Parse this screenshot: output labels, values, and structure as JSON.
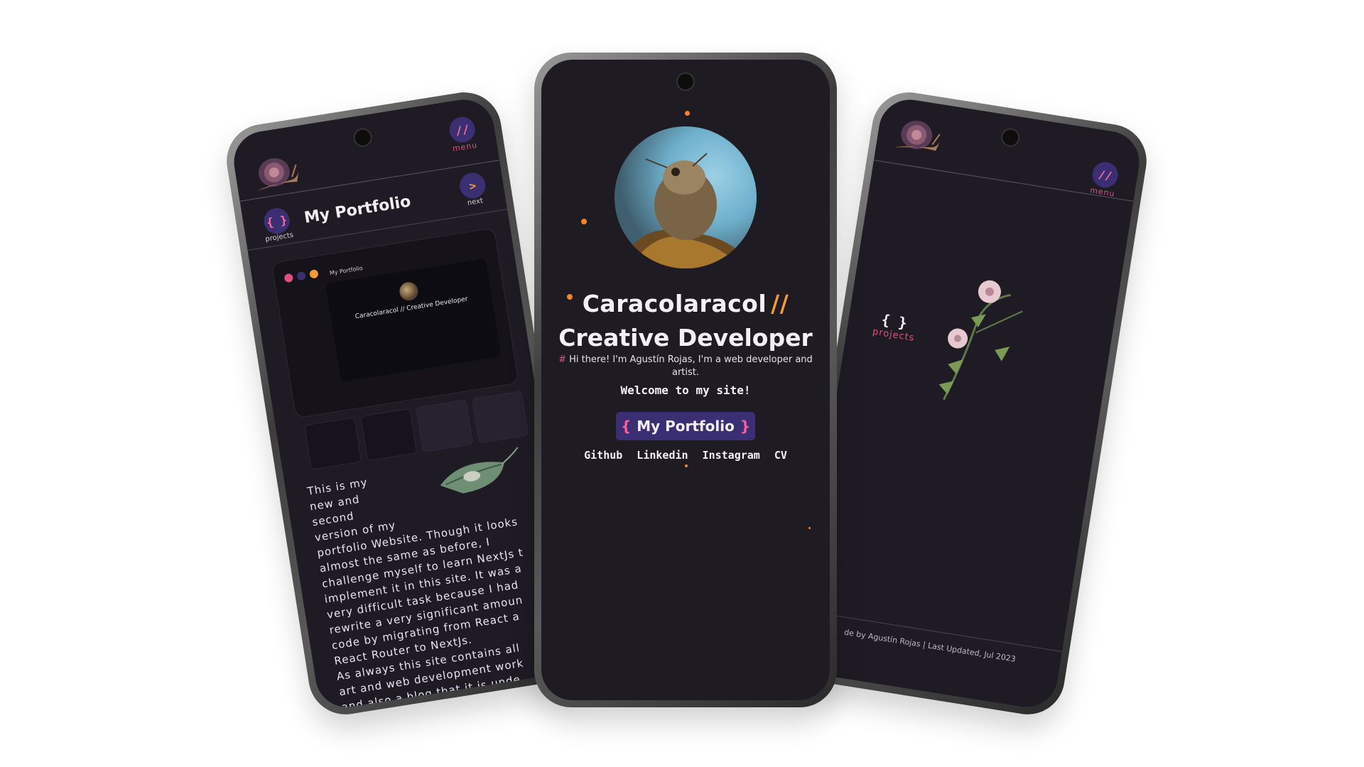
{
  "left_phone": {
    "menu_label": "menu",
    "menu_glyph": "//",
    "projects_label": "projects",
    "projects_glyph": "{ }",
    "next_label": "next",
    "next_glyph": ">",
    "page_title": "My Portfolio",
    "preview": {
      "mini_title": "My Portfolio",
      "mini_heading": "Caracolaracol // Creative Developer"
    },
    "body_text": "This is my\nnew and\nsecond\nversion of my\nportfolio Website. Though it looks\nalmost the same as before, I\nchallenge myself to learn NextJs t\nimplement it in this site. It was a\nvery difficult task because I had\nrewrite a very significant amoun\ncode by migrating from React a\nReact Router to NextJs.\nAs always this site contains all\nart and web development work\nand also a blog that it is unde\nconstruction because I need a"
  },
  "center_phone": {
    "name": "Caracolaracol",
    "slashes": "//",
    "role": "Creative Developer",
    "intro_hash": "#",
    "intro": "Hi there! I'm Agustín Rojas, I'm a web developer and artist.",
    "welcome": "Welcome to my site!",
    "cta_left_brace": "{",
    "cta_label": "My Portfolio",
    "cta_right_brace": "}",
    "links": [
      "Github",
      "Linkedin",
      "Instagram",
      "CV"
    ]
  },
  "right_phone": {
    "menu_label": "menu",
    "menu_glyph": "//",
    "projects_label": "projects",
    "projects_glyph": "{ }",
    "footer": "de by Agustín Rojas | Last Updated, Jul 2023"
  },
  "colors": {
    "background": "#1f1b24",
    "accent_purple": "#3b2f74",
    "accent_pink": "#e0507a",
    "accent_orange": "#f29a3a"
  }
}
